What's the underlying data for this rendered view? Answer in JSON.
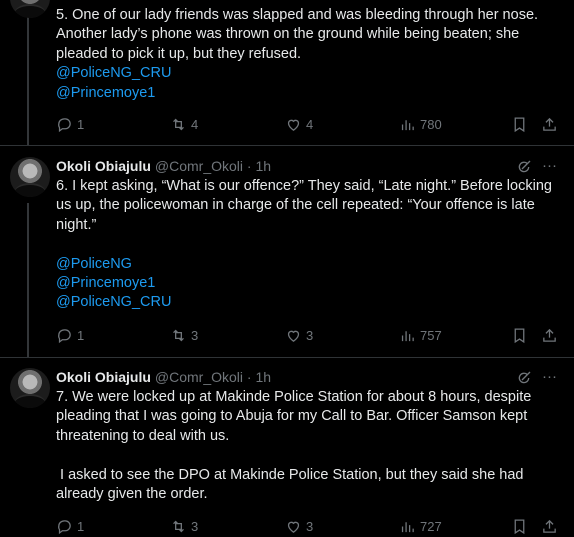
{
  "tweets": [
    {
      "text": "5. One of our lady friends was slapped and was bleeding through her nose. Another lady’s phone was thrown on the ground while being beaten; she pleaded to pick it up, but they refused.",
      "mentions": [
        "@PoliceNG_CRU",
        "@Princemoye1"
      ],
      "replies": "1",
      "reposts": "4",
      "likes": "4",
      "views": "780"
    },
    {
      "author": "Okoli Obiajulu",
      "handle_time": "@Comr_Okoli · 1h",
      "text": "6. I kept asking, “What is our offence?” They said, “Late night.” Before locking us up, the policewoman in charge of the cell repeated: “Your offence is late night.”",
      "mentions": [
        "@PoliceNG",
        "@Princemoye1",
        "@PoliceNG_CRU"
      ],
      "replies": "1",
      "reposts": "3",
      "likes": "3",
      "views": "757"
    },
    {
      "author": "Okoli Obiajulu",
      "handle_time": "@Comr_Okoli · 1h",
      "text": "7. We were locked up at Makinde Police Station for about 8 hours, despite pleading that I was going to Abuja for my Call to Bar. Officer Samson kept threatening to deal with us.",
      "text2": " I asked to see the DPO at Makinde Police Station, but they said she had already given the order.",
      "replies": "1",
      "reposts": "3",
      "likes": "3",
      "views": "727"
    }
  ],
  "more_glyph": "···",
  "icons": [
    "reply-icon",
    "repost-icon",
    "like-icon",
    "views-icon",
    "bookmark-icon",
    "share-icon",
    "grok-icon",
    "more-icon"
  ],
  "colors": {
    "background": "#000000",
    "text": "#e7e9ea",
    "secondary": "#71767b",
    "link": "#1d9bf0",
    "border": "#2f3336"
  }
}
